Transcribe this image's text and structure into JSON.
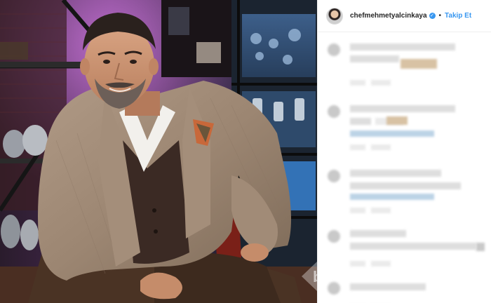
{
  "post": {
    "username": "chefmehmetyalcinkaya",
    "follow_label": "Takip Et",
    "separator": "•"
  },
  "icons": {
    "verified": "verified-badge-icon",
    "watermark": "watermark-logo-icon"
  },
  "colors": {
    "accent": "#3897f0",
    "background": "#ffffff"
  }
}
